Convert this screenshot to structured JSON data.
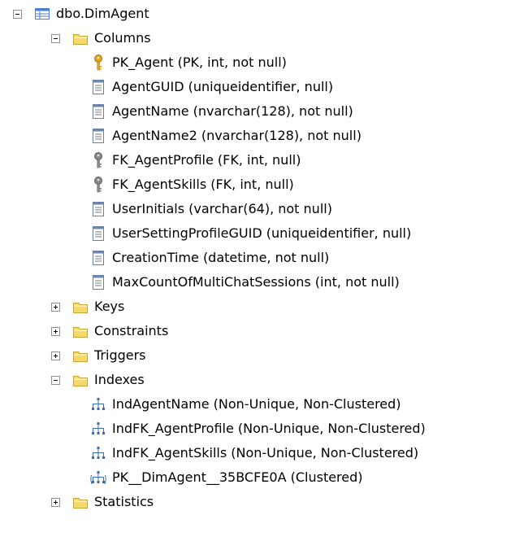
{
  "root": {
    "label": "dbo.DimAgent",
    "icon": "table-icon",
    "expanded": true
  },
  "columns_folder": {
    "label": "Columns",
    "icon": "folder-icon",
    "expanded": true
  },
  "columns": [
    {
      "label": "PK_Agent (PK, int, not null)",
      "icon": "primary-key-icon"
    },
    {
      "label": "AgentGUID (uniqueidentifier, null)",
      "icon": "column-icon"
    },
    {
      "label": "AgentName (nvarchar(128), not null)",
      "icon": "column-icon"
    },
    {
      "label": "AgentName2 (nvarchar(128), not null)",
      "icon": "column-icon"
    },
    {
      "label": "FK_AgentProfile (FK, int, null)",
      "icon": "foreign-key-icon"
    },
    {
      "label": "FK_AgentSkills (FK, int, null)",
      "icon": "foreign-key-icon"
    },
    {
      "label": "UserInitials (varchar(64), not null)",
      "icon": "column-icon"
    },
    {
      "label": "UserSettingProfileGUID (uniqueidentifier, null)",
      "icon": "column-icon"
    },
    {
      "label": "CreationTime (datetime, not null)",
      "icon": "column-icon"
    },
    {
      "label": "MaxCountOfMultiChatSessions (int, not null)",
      "icon": "column-icon"
    }
  ],
  "folders_mid": [
    {
      "label": "Keys",
      "icon": "folder-icon",
      "expanded": false
    },
    {
      "label": "Constraints",
      "icon": "folder-icon",
      "expanded": false
    },
    {
      "label": "Triggers",
      "icon": "folder-icon",
      "expanded": false
    }
  ],
  "indexes_folder": {
    "label": "Indexes",
    "icon": "folder-icon",
    "expanded": true
  },
  "indexes": [
    {
      "label": "IndAgentName (Non-Unique, Non-Clustered)",
      "icon": "index-icon"
    },
    {
      "label": "IndFK_AgentProfile (Non-Unique, Non-Clustered)",
      "icon": "index-icon"
    },
    {
      "label": "IndFK_AgentSkills (Non-Unique, Non-Clustered)",
      "icon": "index-icon"
    },
    {
      "label": "PK__DimAgent__35BCFE0A (Clustered)",
      "icon": "clustered-index-icon"
    }
  ],
  "statistics_folder": {
    "label": "Statistics",
    "icon": "folder-icon",
    "expanded": false
  },
  "colors": {
    "folder_fill": "#f5d96b",
    "folder_edge": "#c9a232",
    "table_blue": "#4a7fc9",
    "key_gold": "#e1a524",
    "key_gray": "#8a8a8a",
    "index_blue": "#3a6db0"
  }
}
